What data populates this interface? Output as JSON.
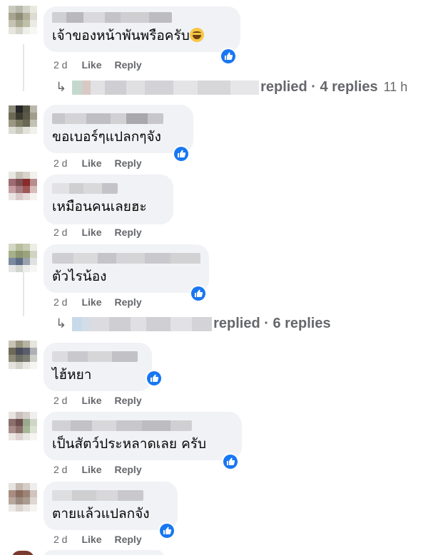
{
  "comments": [
    {
      "text": "เจ้าของหน้าพันพรือครับ",
      "emoji": "grinning-face",
      "time": "2 d",
      "like": "Like",
      "reply": "Reply"
    },
    {
      "text": "ขอเบอร์ๆแปลกๆจัง",
      "time": "2 d",
      "like": "Like",
      "reply": "Reply"
    },
    {
      "text": "เหมือนคนเลยฮะ",
      "time": "2 d",
      "like": "Like",
      "reply": "Reply"
    },
    {
      "text": "ตัวไรน้อง",
      "time": "2 d",
      "like": "Like",
      "reply": "Reply"
    },
    {
      "text": "ไฮ้หยา",
      "time": "2 d",
      "like": "Like",
      "reply": "Reply"
    },
    {
      "text": "เป็นสัตว์ประหลาดเลย ครับ",
      "time": "2 d",
      "like": "Like",
      "reply": "Reply"
    },
    {
      "text": "ตายแล้วแปลกจัง",
      "time": "2 d",
      "like": "Like",
      "reply": "Reply"
    }
  ],
  "reply_threads": [
    {
      "label": "replied · 4 replies",
      "time": "11 h"
    },
    {
      "label": "replied · 6 replies",
      "time": ""
    }
  ],
  "colors": {
    "bubble": "#f0f2f5",
    "meta": "#65676b",
    "like_blue": "#1877f2"
  },
  "icons": {
    "reply_arrow": "↳",
    "like_badge": "thumbs-up-icon"
  }
}
